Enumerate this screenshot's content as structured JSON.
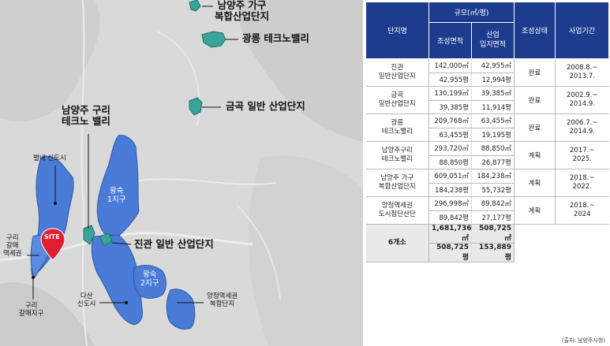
{
  "map": {
    "labels": {
      "gagu": "남양주 가구\n복합산업단지",
      "gwangneung": "광릉 테크노밸리",
      "geumgok": "금곡 일반 산업단지",
      "guri_techno": "남양주 구리\n테크노 밸리",
      "byeollae": "별내 신도시",
      "wangsuk1": "왕숙\n1지구",
      "site": "SITE",
      "guri_station": "구리\n갈매\n역세권",
      "jingwan": "진관 일반 산업단지",
      "wangsuk2": "왕숙\n2지구",
      "dasan": "다산\n신도시",
      "yangjeong": "양정역세권\n복합단지",
      "guri_galmae": "구리\n갈매지구"
    },
    "colors": {
      "blue": "#4a7bd6",
      "teal": "#3aa39a",
      "site": "#e0202f"
    }
  },
  "table": {
    "headers": {
      "name": "단지명",
      "scale": "규모(㎡/평)",
      "area": "조성면적",
      "industrial": "산업\n입지면적",
      "status": "조성상태",
      "period": "사업기간"
    },
    "rows": [
      {
        "name": "진관\n일반산업단지",
        "area_m2": "142,000㎡",
        "ind_m2": "42,955㎡",
        "area_py": "42,955평",
        "ind_py": "12,994평",
        "status": "완료",
        "period": "2008.8.~\n2013.7."
      },
      {
        "name": "금곡\n일반산업단지",
        "area_m2": "130,199㎡",
        "ind_m2": "39,385㎡",
        "area_py": "39,385평",
        "ind_py": "11,914평",
        "status": "완료",
        "period": "2002.9.~\n2014.9."
      },
      {
        "name": "광릉\n테크노밸리",
        "area_m2": "209,768㎡",
        "ind_m2": "63,455㎡",
        "area_py": "63,455평",
        "ind_py": "19,195평",
        "status": "완료",
        "period": "2006.7.~\n2014.9."
      },
      {
        "name": "남양주구리\n테크노밸리",
        "area_m2": "293,720㎡",
        "ind_m2": "88,850㎡",
        "area_py": "88,850평",
        "ind_py": "26,877평",
        "status": "계획",
        "period": "2017.~\n2025."
      },
      {
        "name": "남양주 가구\n복합산업단지",
        "area_m2": "609,051㎡",
        "ind_m2": "184,238㎡",
        "area_py": "184,238평",
        "ind_py": "55,732평",
        "status": "계획",
        "period": "2018.~\n2022."
      },
      {
        "name": "양정역세권\n도시첨단산단",
        "area_m2": "296,998㎡",
        "ind_m2": "89,842㎡",
        "area_py": "89,842평",
        "ind_py": "27,177평",
        "status": "계획",
        "period": "2018.~\n2024"
      }
    ],
    "total": {
      "name": "6개소",
      "area_m2": "1,681,736㎡",
      "ind_m2": "508,725㎡",
      "area_py": "508,725평",
      "ind_py": "153,889평"
    },
    "source": "(출처: 남양주시청)"
  }
}
